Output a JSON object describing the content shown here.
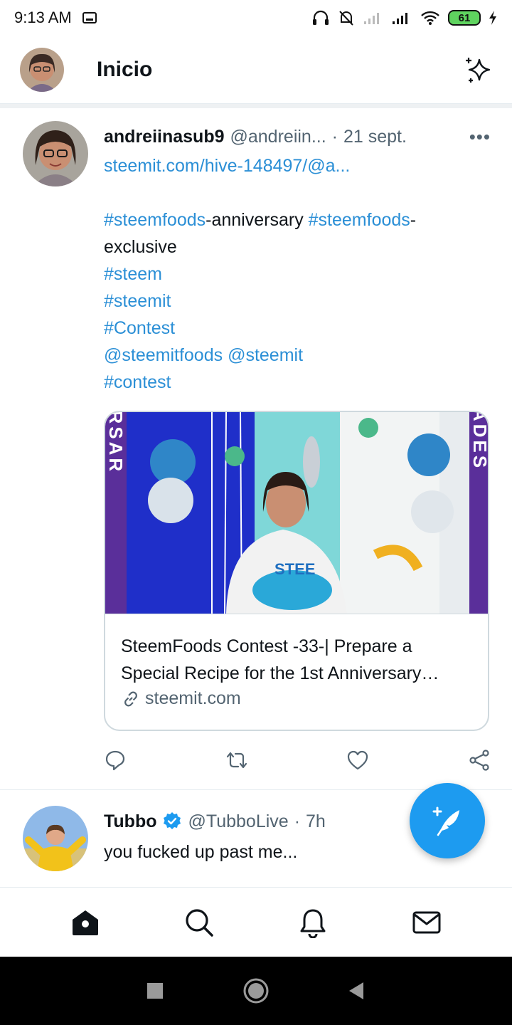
{
  "status_bar": {
    "time": "9:13 AM",
    "battery": "61"
  },
  "header": {
    "title": "Inicio"
  },
  "tweets": [
    {
      "name": "andreiinasub9",
      "handle": "@andreiin...",
      "separator": "·",
      "time": "21 sept.",
      "url_line": "steemit.com/hive-148497/@a...",
      "tags": {
        "steemfoods1": "#steemfoods",
        "anniversary": "-anniversary ",
        "steemfoods2": "#steemfoods",
        "dash": "-",
        "exclusive": "exclusive",
        "steem": "#steem",
        "steemit": "#steemit",
        "contest_cap": "#Contest",
        "mention1": "@steemitfoods",
        "mention2": "@steemit",
        "contest": "#contest"
      },
      "card": {
        "title": "SteemFoods Contest -33-| Prepare a Special Recipe for the 1st Anniversary…",
        "domain": "steemit.com",
        "banner_left": "NIVERSAR",
        "banner_right": "ICIDADES",
        "shirt_text": "STEE"
      }
    },
    {
      "name": "Tubbo",
      "handle": "@TubboLive",
      "separator": "·",
      "time": "7h",
      "text": "you fucked up past me..."
    }
  ],
  "colors": {
    "accent": "#1d9bf0",
    "link": "#2b8fd6",
    "text": "#0f1419",
    "muted": "#536471"
  }
}
